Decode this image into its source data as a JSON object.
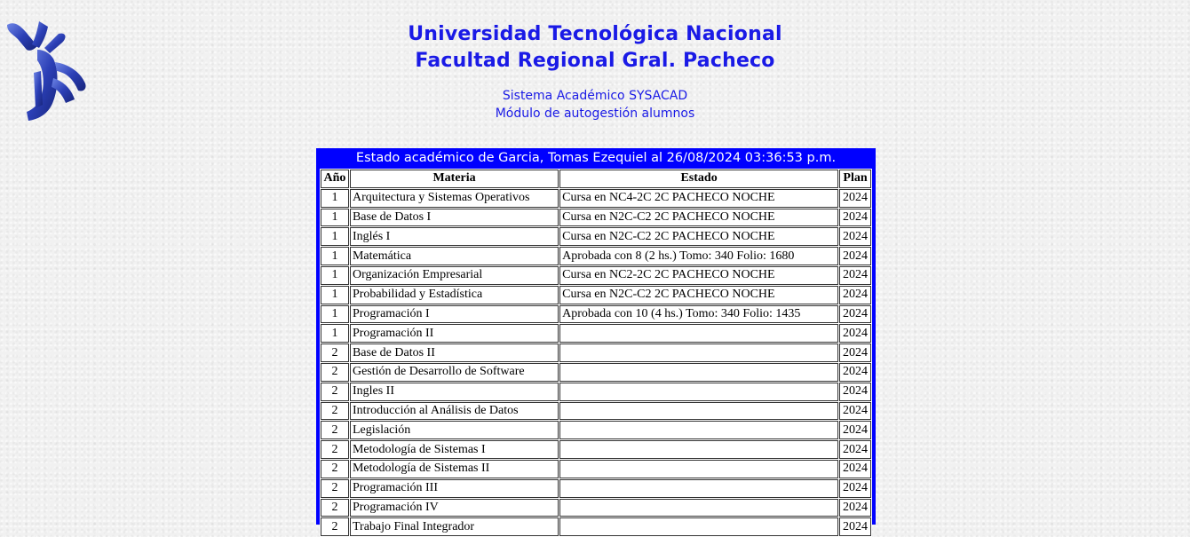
{
  "header": {
    "title_line1": "Universidad Tecnológica Nacional",
    "title_line2": "Facultad Regional Gral. Pacheco",
    "subtitle_line1": "Sistema Académico SYSACAD",
    "subtitle_line2": "Módulo de autogestión alumnos"
  },
  "logo": {
    "icon": "utn-logo-icon"
  },
  "table": {
    "caption": "Estado académico de Garcia, Tomas Ezequiel al 26/08/2024 03:36:53 p.m.",
    "columns": [
      "Año",
      "Materia",
      "Estado",
      "Plan"
    ],
    "rows": [
      {
        "anio": "1",
        "materia": "Arquitectura y Sistemas Operativos",
        "estado": "Cursa en NC4-2C 2C PACHECO NOCHE",
        "plan": "2024"
      },
      {
        "anio": "1",
        "materia": "Base de Datos I",
        "estado": "Cursa en N2C-C2 2C PACHECO NOCHE",
        "plan": "2024"
      },
      {
        "anio": "1",
        "materia": "Inglés I",
        "estado": "Cursa en N2C-C2 2C PACHECO NOCHE",
        "plan": "2024"
      },
      {
        "anio": "1",
        "materia": "Matemática",
        "estado": "Aprobada con 8 (2 hs.) Tomo: 340 Folio: 1680",
        "plan": "2024"
      },
      {
        "anio": "1",
        "materia": "Organización Empresarial",
        "estado": "Cursa en NC2-2C 2C PACHECO NOCHE",
        "plan": "2024"
      },
      {
        "anio": "1",
        "materia": "Probabilidad y Estadística",
        "estado": "Cursa en N2C-C2 2C PACHECO NOCHE",
        "plan": "2024"
      },
      {
        "anio": "1",
        "materia": "Programación I",
        "estado": "Aprobada con 10 (4 hs.) Tomo: 340 Folio: 1435",
        "plan": "2024"
      },
      {
        "anio": "1",
        "materia": "Programación II",
        "estado": "",
        "plan": "2024"
      },
      {
        "anio": "2",
        "materia": "Base de Datos II",
        "estado": "",
        "plan": "2024"
      },
      {
        "anio": "2",
        "materia": "Gestión de Desarrollo de Software",
        "estado": "",
        "plan": "2024"
      },
      {
        "anio": "2",
        "materia": "Ingles II",
        "estado": "",
        "plan": "2024"
      },
      {
        "anio": "2",
        "materia": "Introducción al Análisis de Datos",
        "estado": "",
        "plan": "2024"
      },
      {
        "anio": "2",
        "materia": "Legislación",
        "estado": "",
        "plan": "2024"
      },
      {
        "anio": "2",
        "materia": "Metodología de Sistemas I",
        "estado": "",
        "plan": "2024"
      },
      {
        "anio": "2",
        "materia": "Metodología de Sistemas II",
        "estado": "",
        "plan": "2024"
      },
      {
        "anio": "2",
        "materia": "Programación III",
        "estado": "",
        "plan": "2024"
      },
      {
        "anio": "2",
        "materia": "Programación IV",
        "estado": "",
        "plan": "2024"
      },
      {
        "anio": "2",
        "materia": "Trabajo Final Integrador",
        "estado": "",
        "plan": "2024"
      }
    ]
  },
  "colors": {
    "header_text": "#1a1ae6",
    "panel_blue": "#0000ff",
    "logo_blue": "#2b3fb6"
  }
}
